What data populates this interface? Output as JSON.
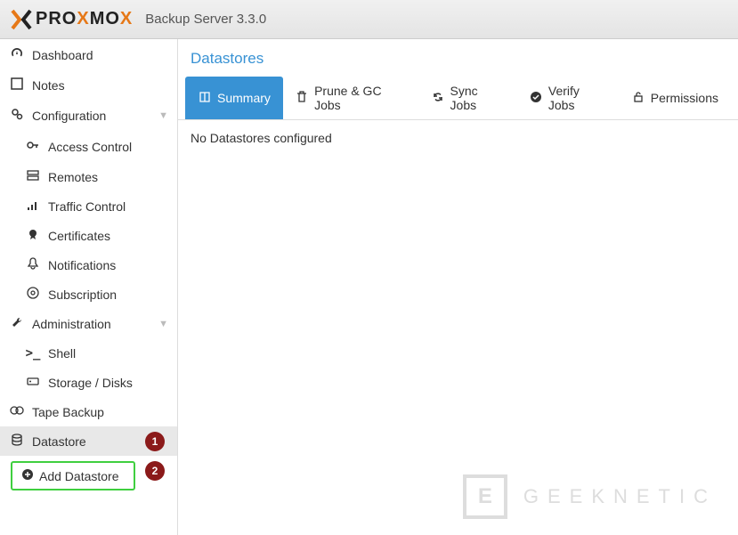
{
  "header": {
    "brand_pre": "PRO",
    "brand_mid": "X",
    "brand_post": "MO",
    "brand_end": "X",
    "title": "Backup Server 3.3.0"
  },
  "sidebar": {
    "dashboard": "Dashboard",
    "notes": "Notes",
    "configuration": "Configuration",
    "access_control": "Access Control",
    "remotes": "Remotes",
    "traffic_control": "Traffic Control",
    "certificates": "Certificates",
    "notifications": "Notifications",
    "subscription": "Subscription",
    "administration": "Administration",
    "shell": "Shell",
    "storage_disks": "Storage / Disks",
    "tape_backup": "Tape Backup",
    "datastore": "Datastore",
    "add_datastore": "Add Datastore"
  },
  "badges": {
    "one": "1",
    "two": "2"
  },
  "content": {
    "title": "Datastores",
    "empty": "No Datastores configured"
  },
  "tabs": {
    "summary": "Summary",
    "prune": "Prune & GC Jobs",
    "sync": "Sync Jobs",
    "verify": "Verify Jobs",
    "permissions": "Permissions"
  },
  "watermark": {
    "box": "E",
    "text": "GEEKNETIC"
  }
}
